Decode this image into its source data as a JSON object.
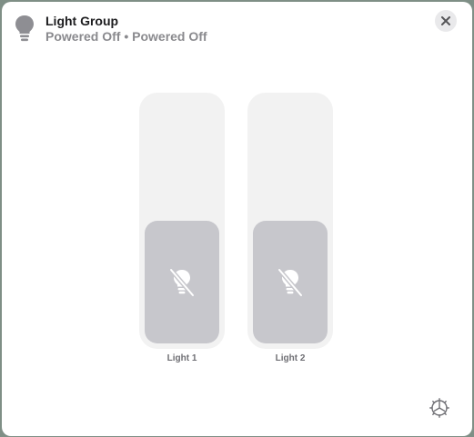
{
  "header": {
    "icon": "lightbulb-icon",
    "title": "Light Group",
    "subtitle": "Powered Off • Powered Off"
  },
  "close_icon": "close-icon",
  "lights": [
    {
      "label": "Light 1",
      "level": 0.5,
      "status_icon": "lightbulb-slash-icon"
    },
    {
      "label": "Light 2",
      "level": 0.5,
      "status_icon": "lightbulb-slash-icon"
    }
  ],
  "settings_icon": "gear-icon",
  "colors": {
    "background": "#ffffff",
    "slider_track": "#f2f2f2",
    "slider_fill": "#c7c7cc",
    "icon_gray": "#8e8e93"
  }
}
